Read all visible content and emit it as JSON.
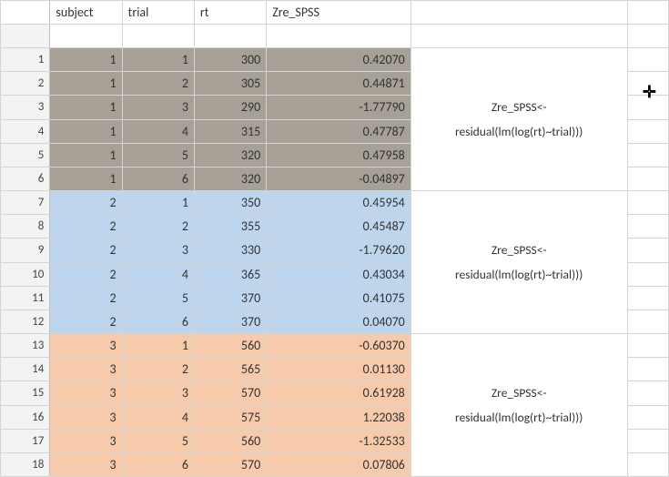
{
  "headers": {
    "subject": "subject",
    "trial": "trial",
    "rt": "rt",
    "zre": "Zre_SPSS"
  },
  "formula": {
    "line1": "Zre_SPSS<-",
    "line2": "residual(lm(log(rt)~trial)))"
  },
  "rows": [
    {
      "n": "1",
      "subject": "1",
      "trial": "1",
      "rt": "300",
      "zre": "0.42070",
      "g": 1
    },
    {
      "n": "2",
      "subject": "1",
      "trial": "2",
      "rt": "305",
      "zre": "0.44871",
      "g": 1
    },
    {
      "n": "3",
      "subject": "1",
      "trial": "3",
      "rt": "290",
      "zre": "-1.77790",
      "g": 1
    },
    {
      "n": "4",
      "subject": "1",
      "trial": "4",
      "rt": "315",
      "zre": "0.47787",
      "g": 1
    },
    {
      "n": "5",
      "subject": "1",
      "trial": "5",
      "rt": "320",
      "zre": "0.47958",
      "g": 1
    },
    {
      "n": "6",
      "subject": "1",
      "trial": "6",
      "rt": "320",
      "zre": "-0.04897",
      "g": 1
    },
    {
      "n": "7",
      "subject": "2",
      "trial": "1",
      "rt": "350",
      "zre": "0.45954",
      "g": 2
    },
    {
      "n": "8",
      "subject": "2",
      "trial": "2",
      "rt": "355",
      "zre": "0.45487",
      "g": 2
    },
    {
      "n": "9",
      "subject": "2",
      "trial": "3",
      "rt": "330",
      "zre": "-1.79620",
      "g": 2
    },
    {
      "n": "10",
      "subject": "2",
      "trial": "4",
      "rt": "365",
      "zre": "0.43034",
      "g": 2
    },
    {
      "n": "11",
      "subject": "2",
      "trial": "5",
      "rt": "370",
      "zre": "0.41075",
      "g": 2
    },
    {
      "n": "12",
      "subject": "2",
      "trial": "6",
      "rt": "370",
      "zre": "0.04070",
      "g": 2
    },
    {
      "n": "13",
      "subject": "3",
      "trial": "1",
      "rt": "560",
      "zre": "-0.60370",
      "g": 3
    },
    {
      "n": "14",
      "subject": "3",
      "trial": "2",
      "rt": "565",
      "zre": "0.01130",
      "g": 3
    },
    {
      "n": "15",
      "subject": "3",
      "trial": "3",
      "rt": "570",
      "zre": "0.61928",
      "g": 3
    },
    {
      "n": "16",
      "subject": "3",
      "trial": "4",
      "rt": "575",
      "zre": "1.22038",
      "g": 3
    },
    {
      "n": "17",
      "subject": "3",
      "trial": "5",
      "rt": "560",
      "zre": "-1.32533",
      "g": 3
    },
    {
      "n": "18",
      "subject": "3",
      "trial": "6",
      "rt": "570",
      "zre": "0.07806",
      "g": 3
    }
  ],
  "cursor": "✛"
}
